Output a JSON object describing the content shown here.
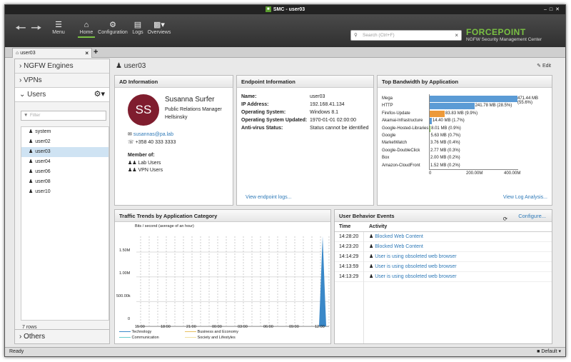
{
  "window_title": "SMC - user03",
  "toolbar": {
    "items": [
      {
        "label": "Menu",
        "icon": "menu-icon"
      },
      {
        "label": "Home",
        "icon": "home-icon"
      },
      {
        "label": "Configuration",
        "icon": "configuration-icon"
      },
      {
        "label": "Logs",
        "icon": "logs-icon"
      },
      {
        "label": "Overviews",
        "icon": "overviews-icon"
      }
    ],
    "search_placeholder": "Search (Ctrl+F)",
    "brand": "FORCEPOINT",
    "brand_sub": "NGFW Security Management Center"
  },
  "tab": {
    "label": "user03"
  },
  "sidebar": {
    "sections": [
      "NGFW Engines",
      "VPNs",
      "Users",
      "Others"
    ],
    "filter_placeholder": "Filter",
    "users": [
      "system",
      "user02",
      "user03",
      "user04",
      "user06",
      "user08",
      "user10"
    ],
    "selected": "user03",
    "row_count": "7 rows"
  },
  "page": {
    "title": "user03",
    "edit": "Edit"
  },
  "ad": {
    "title": "AD Information",
    "initials": "SS",
    "name": "Susanna Surfer",
    "job": "Public Relations Manager",
    "city": "Hellsinsky",
    "email": "susannas@pa.lab",
    "phone": "+358 40 333 3333",
    "member_label": "Member of:",
    "groups": [
      "Lab Users",
      "VPN Users"
    ]
  },
  "endpoint": {
    "title": "Endpoint Information",
    "rows": [
      {
        "k": "Name:",
        "v": "user03"
      },
      {
        "k": "IP Address:",
        "v": "192.168.41.134"
      },
      {
        "k": "Operating System:",
        "v": "Windows 8.1"
      },
      {
        "k": "Operating System Updated:",
        "v": "1970-01-01 02:00:00"
      },
      {
        "k": "Anti-virus Status:",
        "v": "Status cannot be identified"
      }
    ],
    "link": "View endpoint logs..."
  },
  "bandwidth": {
    "title": "Top Bandwidth by Application",
    "max": 471.44,
    "apps": [
      {
        "name": "Mega",
        "mb": 471.44,
        "label": "471.44 MB (55.6%)",
        "color": "#5b9bd5"
      },
      {
        "name": "HTTP",
        "mb": 241.78,
        "label": "241.78 MB (28.5%)",
        "color": "#5b9bd5"
      },
      {
        "name": "Firefox-Update",
        "mb": 83.83,
        "label": "83.83 MB (9.9%)",
        "color": "#ed9a3a"
      },
      {
        "name": "Akamai-Infrastructure",
        "mb": 14.4,
        "label": "14.40 MB (1.7%)",
        "color": "#5b9bd5"
      },
      {
        "name": "Google-Hosted-Libraries",
        "mb": 8.01,
        "label": "8.01 MB (0.9%)",
        "color": "#7ac143"
      },
      {
        "name": "Google",
        "mb": 5.63,
        "label": "5.63 MB (0.7%)",
        "color": "#5b9bd5"
      },
      {
        "name": "MarketWatch",
        "mb": 3.76,
        "label": "3.76 MB (0.4%)",
        "color": "#5b9bd5"
      },
      {
        "name": "Google-DoubleClick",
        "mb": 2.77,
        "label": "2.77 MB (0.3%)",
        "color": "#5b9bd5"
      },
      {
        "name": "Box",
        "mb": 2.0,
        "label": "2.00 MB (0.2%)",
        "color": "#5b9bd5"
      },
      {
        "name": "Amazon-CloudFront",
        "mb": 1.52,
        "label": "1.52 MB (0.2%)",
        "color": "#5b9bd5"
      }
    ],
    "axis": [
      "0",
      "200.00M",
      "400.00M"
    ],
    "link": "View Log Analysis..."
  },
  "traffic": {
    "title": "Traffic Trends by Application Category",
    "ylabel": "Bits / second (average of an hour)",
    "yticks": [
      "1.50M",
      "1.00M",
      "500.00k",
      "0"
    ],
    "xticks": [
      "15:00",
      "18:00",
      "21:00",
      "00:00",
      "03:00",
      "06:00",
      "09:00",
      "12:00"
    ],
    "legend": [
      "Technology",
      "Communication",
      "Business and Economy",
      "Society and Lifestyles"
    ]
  },
  "events": {
    "title": "User Behavior Events",
    "configure": "Configure...",
    "col_time": "Time",
    "col_activity": "Activity",
    "rows": [
      {
        "time": "14:28:20",
        "activity": "Blocked Web Content"
      },
      {
        "time": "14:23:20",
        "activity": "Blocked Web Content"
      },
      {
        "time": "14:14:29",
        "activity": "User is using obsoleted web browser"
      },
      {
        "time": "14:13:59",
        "activity": "User is using obsoleted web browser"
      },
      {
        "time": "14:13:29",
        "activity": "User is using obsoleted web browser"
      }
    ]
  },
  "status": {
    "text": "Ready",
    "lang": "Default"
  }
}
